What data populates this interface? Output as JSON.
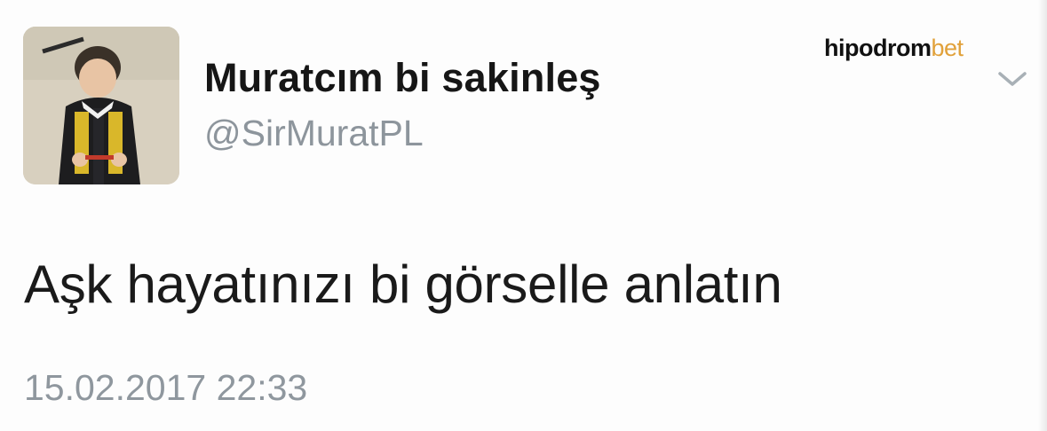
{
  "tweet": {
    "author": {
      "display_name": "Muratcım bi sakinleş",
      "handle": "@SirMuratPL"
    },
    "text": "Aşk hayatınızı bi görselle anlatın",
    "timestamp": "15.02.2017 22:33",
    "menu_icon": "chevron-down-icon"
  },
  "watermark": {
    "part1": "hipodrom",
    "part2": "bet",
    "accent_color": "#e1a13a"
  },
  "colors": {
    "name": "#161616",
    "secondary_text": "#8d959c"
  }
}
